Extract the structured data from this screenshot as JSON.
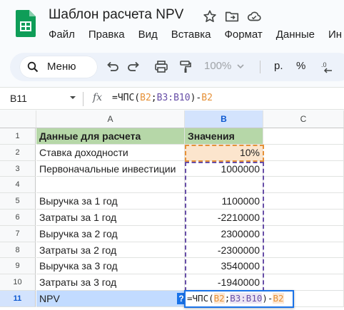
{
  "app": {
    "doc_title": "Шаблон расчета NPV",
    "menu": [
      "Файл",
      "Правка",
      "Вид",
      "Вставка",
      "Формат",
      "Данные",
      "Ин"
    ]
  },
  "toolbar": {
    "menu_search_label": "Меню",
    "zoom": "100%",
    "currency_format": "р.",
    "percent_format": "%"
  },
  "formula_bar": {
    "name_box": "B11",
    "fx": "fx",
    "formula_parts": [
      "=ЧПС(",
      "B2",
      ";",
      "B3:B10",
      ")-",
      "B2"
    ]
  },
  "sheet": {
    "columns": [
      "A",
      "B",
      "C"
    ],
    "rows": [
      {
        "num": "1",
        "a": "Данные для расчета",
        "b": "Значения"
      },
      {
        "num": "2",
        "a": "Ставка доходности",
        "b": "10%"
      },
      {
        "num": "3",
        "a": "Первоначальные инвестиции",
        "b": "1000000"
      },
      {
        "num": "4",
        "a": "",
        "b": ""
      },
      {
        "num": "5",
        "a": "Выручка за 1 год",
        "b": "1100000"
      },
      {
        "num": "6",
        "a": "Затраты за 1 год",
        "b": "-2210000"
      },
      {
        "num": "7",
        "a": "Выручка за 2 год",
        "b": "2300000"
      },
      {
        "num": "8",
        "a": "Затраты за 2 год",
        "b": "-2300000"
      },
      {
        "num": "9",
        "a": "Выручка за 3 год",
        "b": "3540000"
      },
      {
        "num": "10",
        "a": "Затраты за 3 год",
        "b": "-1940000"
      },
      {
        "num": "11",
        "a": "NPV",
        "b": ""
      }
    ],
    "active_cell_badge": "?"
  },
  "colors": {
    "header_fill": "#b6d7a8",
    "b2_highlight": "#fce5cd",
    "b2_ref": "#e69138",
    "range_ref": "#674ea7",
    "active_row": "#c2dbff",
    "selection": "#1a73e8"
  }
}
